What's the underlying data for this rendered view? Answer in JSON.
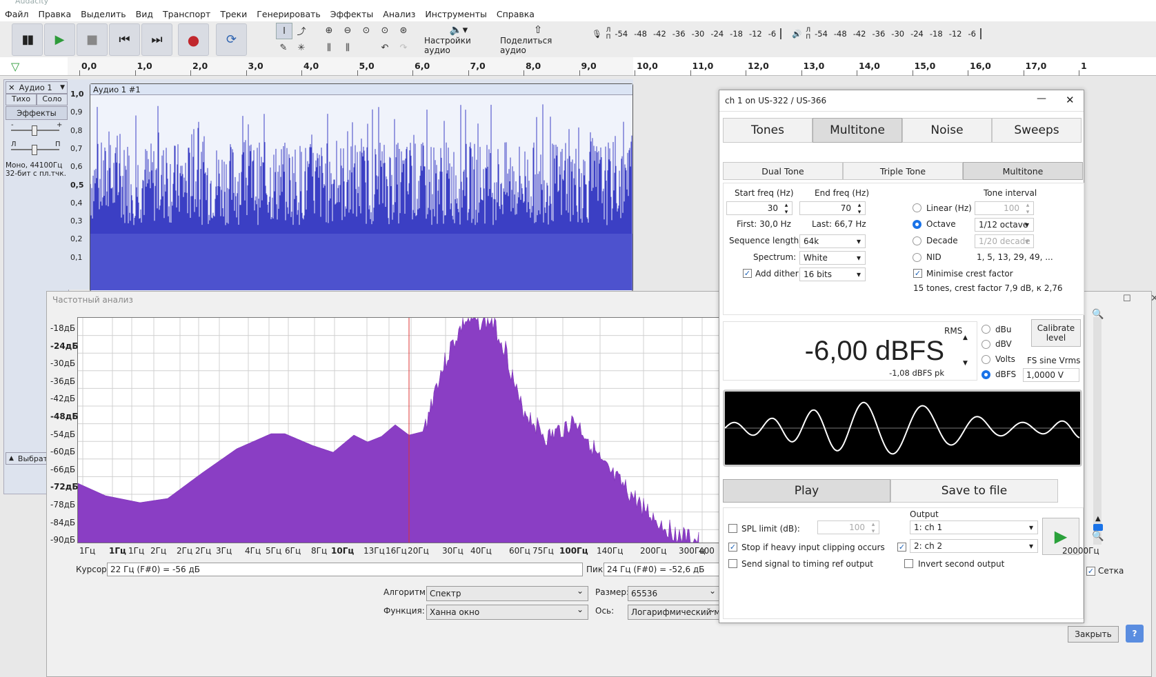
{
  "app": {
    "title": "Audacity"
  },
  "menu": [
    "Файл",
    "Правка",
    "Выделить",
    "Вид",
    "Транспорт",
    "Треки",
    "Генерировать",
    "Эффекты",
    "Анализ",
    "Инструменты",
    "Справка"
  ],
  "toolbar": {
    "audio_setup": "Настройки аудио",
    "share_audio": "Поделиться аудио",
    "meter_ticks": [
      "-54",
      "-48",
      "-42",
      "-36",
      "-30",
      "-24",
      "-18",
      "-12",
      "-6"
    ],
    "rec_lr": [
      "Л",
      "П"
    ],
    "play_lr": [
      "Л",
      "П"
    ]
  },
  "ruler": {
    "ticks": [
      "0,0",
      "1,0",
      "2,0",
      "3,0",
      "4,0",
      "5,0",
      "6,0",
      "7,0",
      "8,0",
      "9,0",
      "10,0",
      "11,0",
      "12,0",
      "13,0",
      "14,0",
      "15,0",
      "16,0",
      "17,0",
      "1"
    ]
  },
  "track": {
    "name": "Аудио 1",
    "mute": "Тихо",
    "solo": "Соло",
    "effects": "Эффекты",
    "gain_minus": "-",
    "gain_plus": "+",
    "pan_left": "Л",
    "pan_right": "П",
    "info1": "Моно, 44100Гц",
    "info2": "32-бит с пл.тчк.",
    "select": "Выбрать",
    "clip_name": "Аудио 1 #1",
    "y_ticks": [
      "1,0",
      "0,9",
      "0,8",
      "0,7",
      "0,6",
      "0,5",
      "0,4",
      "0,3",
      "0,2",
      "0,1"
    ]
  },
  "freq_window": {
    "title": "Частотный анализ",
    "y_ticks": [
      "-18дБ",
      "-24дБ",
      "-30дБ",
      "-36дБ",
      "-42дБ",
      "-48дБ",
      "-54дБ",
      "-60дБ",
      "-66дБ",
      "-72дБ",
      "-78дБ",
      "-84дБ",
      "-90дБ"
    ],
    "x_ticks": [
      "1Гц",
      "1Гц",
      "1Гц",
      "2Гц",
      "2Гц",
      "2Гц",
      "3Гц",
      "4Гц",
      "5Гц",
      "6Гц",
      "8Гц",
      "10Гц",
      "13Гц",
      "16Гц",
      "20Гц",
      "30Гц",
      "40Гц",
      "60Гц",
      "75Гц",
      "100Гц",
      "140Гц",
      "200Гц",
      "300Гц",
      "400",
      "20000Гц"
    ],
    "cursor_label": "Курсор:",
    "cursor_value": "22 Гц (F#0) = -56 дБ",
    "peak_label": "Пик:",
    "peak_value": "24 Гц (F#0) = -52,6 дБ",
    "algorithm_label": "Алгоритм:",
    "algorithm_value": "Спектр",
    "size_label": "Размер:",
    "size_value": "65536",
    "function_label": "Функция:",
    "function_value": "Ханна  окно",
    "axis_label": "Ось:",
    "axis_value": "Логарифмический масш",
    "grid_label": "Сетка",
    "close_button": "Закрыть",
    "help_button": "?"
  },
  "generator": {
    "title": "ch 1 on US-322 / US-366",
    "main_tabs": [
      "Tones",
      "Multitone",
      "Noise",
      "Sweeps"
    ],
    "active_main_tab": "Multitone",
    "sub_tabs": [
      "Dual Tone",
      "Triple Tone",
      "Multitone"
    ],
    "start_freq_label": "Start freq (Hz)",
    "start_freq": "30",
    "end_freq_label": "End freq (Hz)",
    "end_freq": "70",
    "first": "First: 30,0 Hz",
    "last": "Last: 66,7 Hz",
    "tone_interval_label": "Tone interval",
    "linear_label": "Linear (Hz)",
    "linear_value": "100",
    "octave_label": "Octave",
    "octave_value": "1/12 octave",
    "decade_label": "Decade",
    "decade_value": "1/20 decade",
    "nid_label": "NID",
    "nid_value": "1, 5, 13, 29, 49, ...",
    "seq_len_label": "Sequence length:",
    "seq_len": "64k",
    "spectrum_label": "Spectrum:",
    "spectrum": "White",
    "add_dither_label": "Add dither",
    "dither_bits": "16 bits",
    "minimise_crest_label": "Minimise crest factor",
    "tones_info": "15 tones, crest factor 7,9 dB, к 2,76",
    "rms_label": "RMS",
    "level_value": "-6,00 dBFS",
    "peak_value": "-1,08 dBFS pk",
    "units": [
      "dBu",
      "dBV",
      "Volts",
      "dBFS"
    ],
    "calibrate": "Calibrate level",
    "fs_sine_label": "FS sine Vrms",
    "fs_sine_value": "1,0000 V",
    "play": "Play",
    "save": "Save to file",
    "output_label": "Output",
    "spl_limit_label": "SPL limit (dB):",
    "spl_limit_value": "100",
    "output1": "1: ch 1",
    "output2": "2: ch 2",
    "stop_clip_label": "Stop if heavy input clipping occurs",
    "send_signal_label": "Send signal to timing ref output",
    "invert_label": "Invert second output"
  }
}
